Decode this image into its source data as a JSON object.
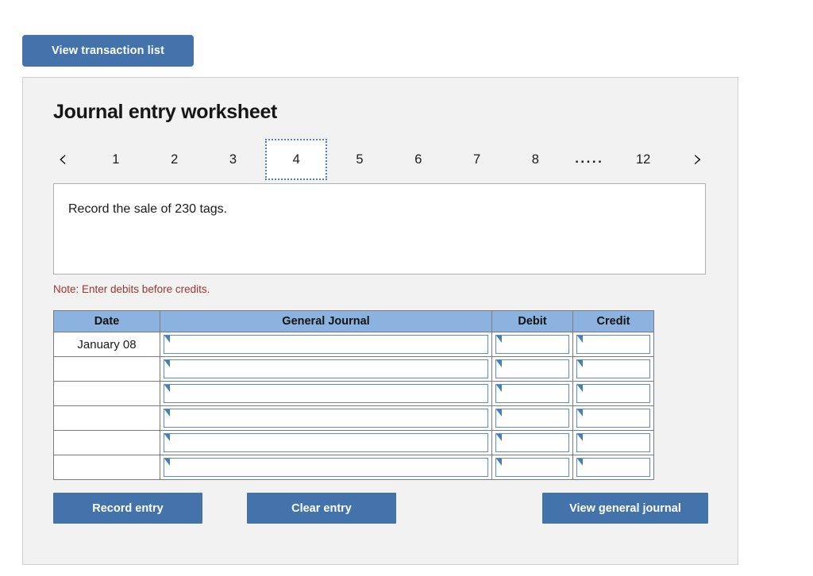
{
  "top_bar": {
    "view_transaction_label": "View transaction list"
  },
  "worksheet": {
    "title": "Journal entry worksheet",
    "pager": {
      "prev_icon": "chevron-left-icon",
      "next_icon": "chevron-right-icon",
      "pages": [
        "1",
        "2",
        "3",
        "4",
        "5",
        "6",
        "7",
        "8"
      ],
      "ellipsis": ".....",
      "last_page": "12",
      "current_page": "4"
    },
    "transaction": {
      "description": "Record the sale of 230 tags."
    },
    "note": "Note: Enter debits before credits.",
    "table": {
      "headers": [
        "Date",
        "General Journal",
        "Debit",
        "Credit"
      ],
      "rows": [
        {
          "date": "January 08",
          "general_journal": "",
          "debit": "",
          "credit": ""
        },
        {
          "date": "",
          "general_journal": "",
          "debit": "",
          "credit": ""
        },
        {
          "date": "",
          "general_journal": "",
          "debit": "",
          "credit": ""
        },
        {
          "date": "",
          "general_journal": "",
          "debit": "",
          "credit": ""
        },
        {
          "date": "",
          "general_journal": "",
          "debit": "",
          "credit": ""
        },
        {
          "date": "",
          "general_journal": "",
          "debit": "",
          "credit": ""
        }
      ]
    },
    "actions": {
      "record_entry": "Record entry",
      "clear_entry": "Clear entry",
      "view_general_journal": "View general journal"
    }
  },
  "colors": {
    "button_blue": "#4472ab",
    "header_blue": "#8cb3e0",
    "note_red": "#9e3434",
    "panel_gray": "#f2f2f2",
    "input_border_blue": "#5b8cc8"
  }
}
